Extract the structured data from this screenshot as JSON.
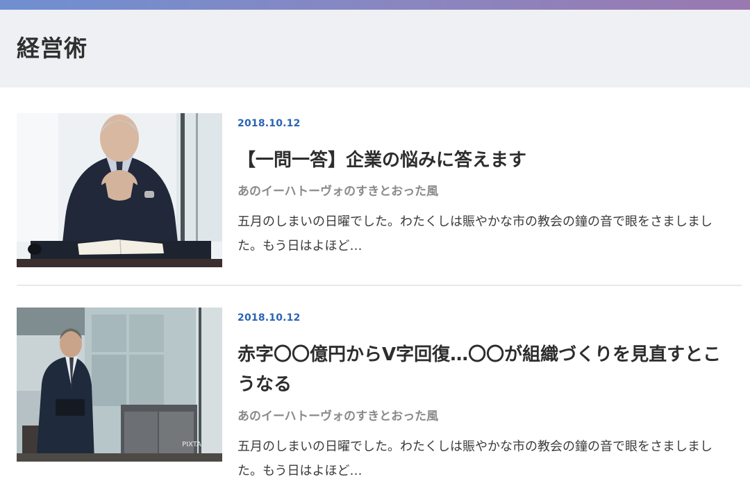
{
  "header": {
    "title": "経営術"
  },
  "posts": [
    {
      "date": "2018.10.12",
      "title": "【一問一答】企業の悩みに答えます",
      "author": "あのイーハトーヴォのすきとおった風",
      "excerpt": "五月のしまいの日曜でした。わたくしは賑やかな市の教会の鐘の音で眼をさましました。もう日はよほど…",
      "thumbnail": "businessman-seated-at-desk-photo"
    },
    {
      "date": "2018.10.12",
      "title": "赤字〇〇億円からV字回復…〇〇が組織づくりを見直すとこうなる",
      "author": "あのイーハトーヴォのすきとおった風",
      "excerpt": "五月のしまいの日曜でした。わたくしは賑やかな市の教会の鐘の音で眼をさましました。もう日はよほど…",
      "thumbnail": "businessman-standing-in-lobby-photo",
      "watermark": "PIXTA"
    }
  ],
  "colors": {
    "accent_date": "#2a63b5",
    "header_bg": "#eff0f3",
    "top_bar_start": "#6f8fd1",
    "top_bar_end": "#9a78b0"
  }
}
